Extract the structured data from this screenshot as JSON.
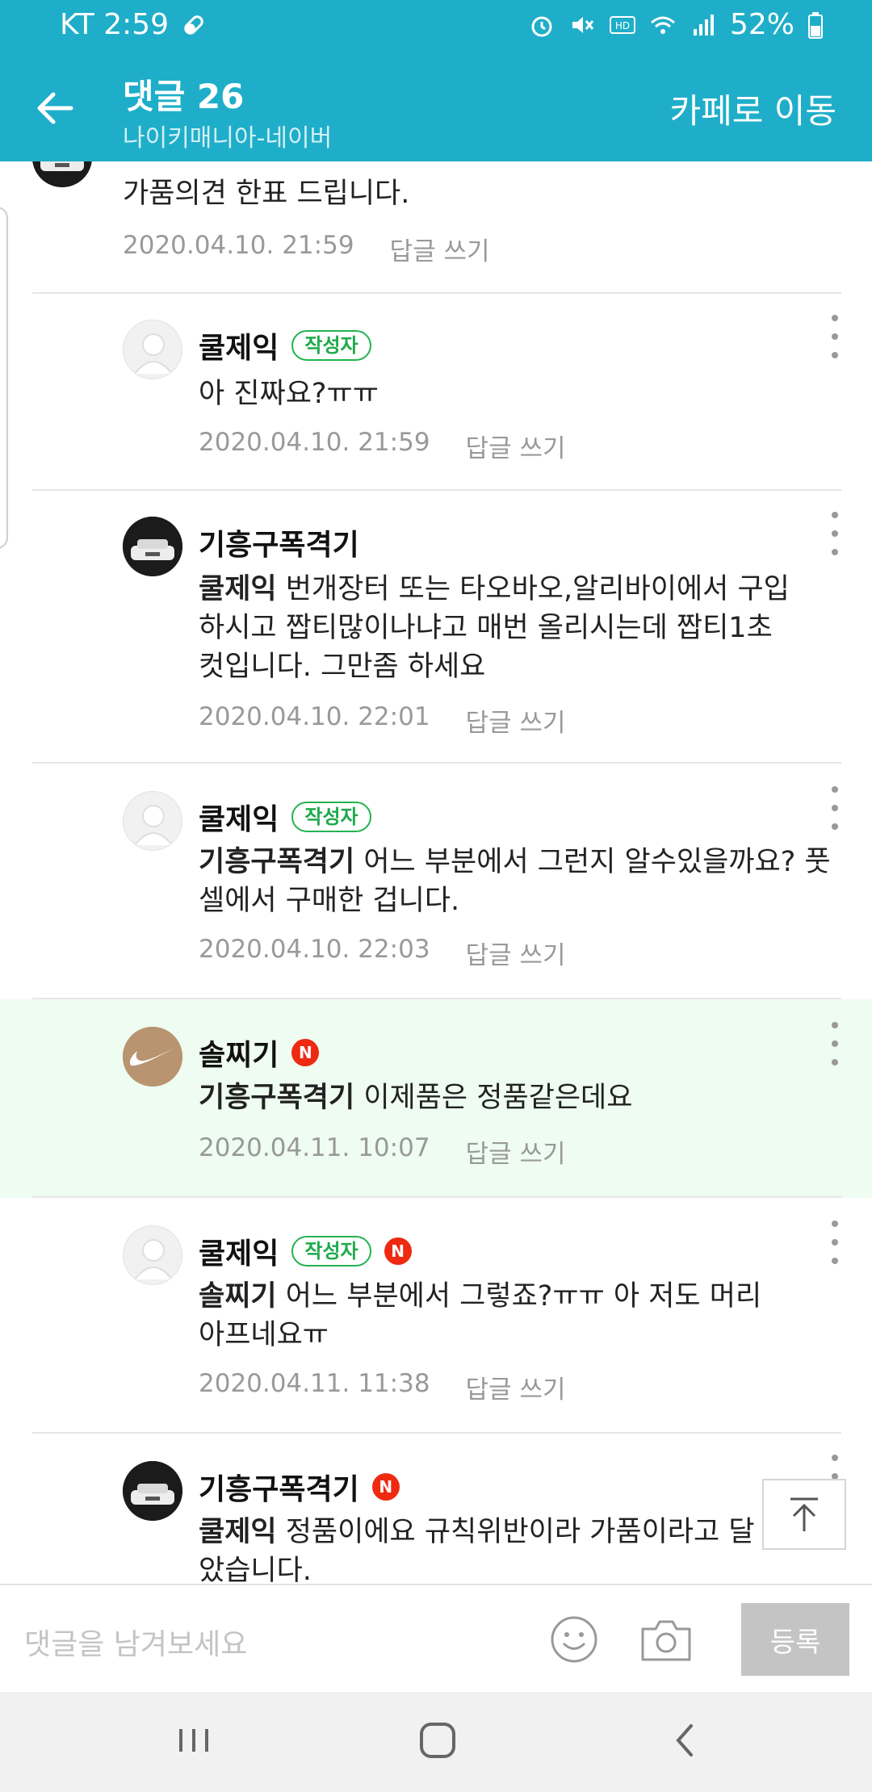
{
  "status_bar": {
    "carrier_time": "KT 2:59",
    "battery": "52%"
  },
  "header": {
    "title": "댓글 26",
    "subtitle": "나이키매니아-네이버",
    "cafe_button": "카페로 이동"
  },
  "comments": [
    {
      "author": "",
      "author_badge": "",
      "mention": "",
      "text": "가품의견 한표 드립니다.",
      "date": "2020.04.10. 21:59",
      "reply_label": "답글 쓰기",
      "avatar": "car-photo"
    },
    {
      "author": "쿨제익",
      "author_badge": "작성자",
      "mention": "",
      "text": "아 진짜요?ㅠㅠ",
      "date": "2020.04.10. 21:59",
      "reply_label": "답글 쓰기",
      "avatar": "default-profile"
    },
    {
      "author": "기흥구폭격기",
      "author_badge": "",
      "mention": "쿨제익",
      "text": " 번개장터 또는 타오바오,알리바이에서 구입하시고 짭티많이나냐고 매번 올리시는데 짭티1초컷입니다. 그만좀 하세요",
      "date": "2020.04.10. 22:01",
      "reply_label": "답글 쓰기",
      "avatar": "car-photo"
    },
    {
      "author": "쿨제익",
      "author_badge": "작성자",
      "mention": "기흥구폭격기",
      "text": " 어느 부분에서 그런지 알수있을까요? 풋셀에서 구매한 겁니다.",
      "date": "2020.04.10. 22:03",
      "reply_label": "답글 쓰기",
      "avatar": "default-profile"
    },
    {
      "author": "솔찌기",
      "author_badge": "N",
      "mention": "기흥구폭격기",
      "text": " 이제품은 정품같은데요",
      "date": "2020.04.11. 10:07",
      "reply_label": "답글 쓰기",
      "avatar": "nike-logo"
    },
    {
      "author": "쿨제익",
      "author_badge": "작성자",
      "new_badge": "N",
      "mention": "솔찌기",
      "text": " 어느 부분에서 그렇죠?ㅠㅠ 아 저도 머리아프네요ㅠ",
      "date": "2020.04.11. 11:38",
      "reply_label": "답글 쓰기",
      "avatar": "default-profile"
    },
    {
      "author": "기흥구폭격기",
      "author_badge": "N",
      "mention": "쿨제익",
      "text": " 정품이에요 규칙위반이라 가품이라고 달았습니다.",
      "date": "",
      "reply_label": "",
      "avatar": "car-photo"
    }
  ],
  "input_bar": {
    "placeholder": "댓글을 남겨보세요",
    "submit_label": "등록"
  },
  "colors": {
    "header_bg": "#1faec9",
    "author_badge": "#22b34f",
    "new_badge": "#ee2a11",
    "highlight_bg": "#eefcf1"
  },
  "icons": [
    "back-arrow-icon",
    "more-vert-icon",
    "scroll-top-icon",
    "emoji-icon",
    "camera-icon",
    "recent-apps-icon",
    "home-icon",
    "nav-back-icon"
  ]
}
